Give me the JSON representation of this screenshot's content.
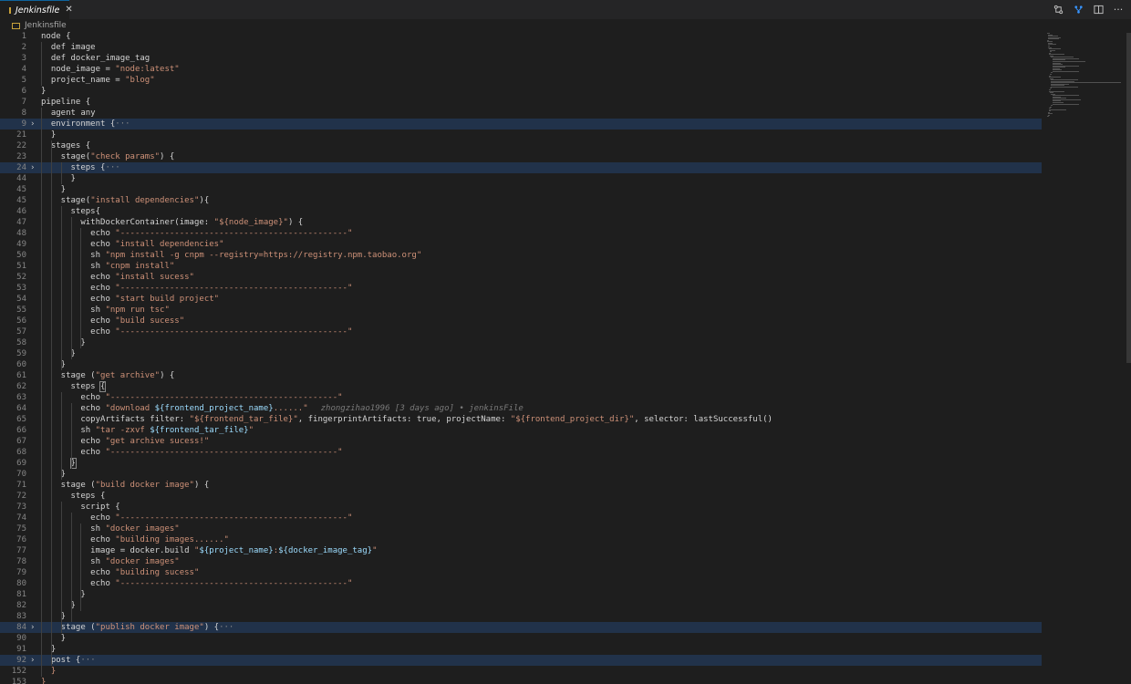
{
  "tab": {
    "label": "Jenkinsfile",
    "close": "✕"
  },
  "breadcrumb": {
    "label": "Jenkinsfile"
  },
  "actions": {
    "more": "···"
  },
  "blame": "zhongzihao1996 [3 days ago] • jenkinsFile",
  "lines": [
    {
      "n": "1",
      "fold": "",
      "hl": false,
      "code": [
        {
          "t": "node {",
          "c": "kw"
        }
      ]
    },
    {
      "n": "2",
      "fold": "",
      "hl": false,
      "code": [
        {
          "t": "  def image",
          "c": "kw"
        }
      ]
    },
    {
      "n": "3",
      "fold": "",
      "hl": false,
      "code": [
        {
          "t": "  def docker_image_tag",
          "c": "kw"
        }
      ]
    },
    {
      "n": "4",
      "fold": "",
      "hl": false,
      "code": [
        {
          "t": "  node_image = ",
          "c": "kw"
        },
        {
          "t": "\"node:latest\"",
          "c": "str"
        }
      ]
    },
    {
      "n": "5",
      "fold": "",
      "hl": false,
      "code": [
        {
          "t": "  project_name = ",
          "c": "kw"
        },
        {
          "t": "\"blog\"",
          "c": "str"
        }
      ]
    },
    {
      "n": "6",
      "fold": "",
      "hl": false,
      "code": [
        {
          "t": "}",
          "c": "kw"
        }
      ]
    },
    {
      "n": "7",
      "fold": "",
      "hl": false,
      "code": [
        {
          "t": "pipeline {",
          "c": "kw"
        }
      ]
    },
    {
      "n": "8",
      "fold": "",
      "hl": false,
      "code": [
        {
          "t": "  agent any",
          "c": "kw"
        }
      ]
    },
    {
      "n": "9",
      "fold": "›",
      "hl": true,
      "code": [
        {
          "t": "  environment {",
          "c": "kw"
        },
        {
          "t": "···",
          "c": "ell"
        }
      ]
    },
    {
      "n": "21",
      "fold": "",
      "hl": false,
      "code": [
        {
          "t": "  }",
          "c": "kw"
        }
      ]
    },
    {
      "n": "22",
      "fold": "",
      "hl": false,
      "code": [
        {
          "t": "  stages {",
          "c": "kw"
        }
      ]
    },
    {
      "n": "23",
      "fold": "",
      "hl": false,
      "code": [
        {
          "t": "    stage(",
          "c": "kw"
        },
        {
          "t": "\"check params\"",
          "c": "str"
        },
        {
          "t": ") {",
          "c": "kw"
        }
      ]
    },
    {
      "n": "24",
      "fold": "›",
      "hl": true,
      "code": [
        {
          "t": "      steps {",
          "c": "kw"
        },
        {
          "t": "···",
          "c": "ell"
        }
      ]
    },
    {
      "n": "44",
      "fold": "",
      "hl": false,
      "code": [
        {
          "t": "      }",
          "c": "kw"
        }
      ]
    },
    {
      "n": "45",
      "fold": "",
      "hl": false,
      "code": [
        {
          "t": "    }",
          "c": "kw"
        }
      ]
    },
    {
      "n": "45",
      "fold": "",
      "hl": false,
      "code": [
        {
          "t": "    stage(",
          "c": "kw"
        },
        {
          "t": "\"install dependencies\"",
          "c": "str"
        },
        {
          "t": "){",
          "c": "kw"
        }
      ]
    },
    {
      "n": "46",
      "fold": "",
      "hl": false,
      "code": [
        {
          "t": "      steps{",
          "c": "kw"
        }
      ]
    },
    {
      "n": "47",
      "fold": "",
      "hl": false,
      "code": [
        {
          "t": "        withDockerContainer(image: ",
          "c": "kw"
        },
        {
          "t": "\"${node_image}\"",
          "c": "str"
        },
        {
          "t": ") {",
          "c": "kw"
        }
      ]
    },
    {
      "n": "48",
      "fold": "",
      "hl": false,
      "code": [
        {
          "t": "          echo ",
          "c": "kw"
        },
        {
          "t": "\"----------------------------------------------\"",
          "c": "str"
        }
      ]
    },
    {
      "n": "49",
      "fold": "",
      "hl": false,
      "code": [
        {
          "t": "          echo ",
          "c": "kw"
        },
        {
          "t": "\"install dependencies\"",
          "c": "str"
        }
      ]
    },
    {
      "n": "50",
      "fold": "",
      "hl": false,
      "code": [
        {
          "t": "          sh ",
          "c": "kw"
        },
        {
          "t": "\"npm install -g cnpm --registry=https://registry.npm.taobao.org\"",
          "c": "str"
        }
      ]
    },
    {
      "n": "51",
      "fold": "",
      "hl": false,
      "code": [
        {
          "t": "          sh ",
          "c": "kw"
        },
        {
          "t": "\"cnpm install\"",
          "c": "str"
        }
      ]
    },
    {
      "n": "52",
      "fold": "",
      "hl": false,
      "code": [
        {
          "t": "          echo ",
          "c": "kw"
        },
        {
          "t": "\"install sucess\"",
          "c": "str"
        }
      ]
    },
    {
      "n": "53",
      "fold": "",
      "hl": false,
      "code": [
        {
          "t": "          echo ",
          "c": "kw"
        },
        {
          "t": "\"----------------------------------------------\"",
          "c": "str"
        }
      ]
    },
    {
      "n": "54",
      "fold": "",
      "hl": false,
      "code": [
        {
          "t": "          echo ",
          "c": "kw"
        },
        {
          "t": "\"start build project\"",
          "c": "str"
        }
      ]
    },
    {
      "n": "55",
      "fold": "",
      "hl": false,
      "code": [
        {
          "t": "          sh ",
          "c": "kw"
        },
        {
          "t": "\"npm run tsc\"",
          "c": "str"
        }
      ]
    },
    {
      "n": "56",
      "fold": "",
      "hl": false,
      "code": [
        {
          "t": "          echo ",
          "c": "kw"
        },
        {
          "t": "\"build sucess\"",
          "c": "str"
        }
      ]
    },
    {
      "n": "57",
      "fold": "",
      "hl": false,
      "code": [
        {
          "t": "          echo ",
          "c": "kw"
        },
        {
          "t": "\"----------------------------------------------\"",
          "c": "str"
        }
      ]
    },
    {
      "n": "58",
      "fold": "",
      "hl": false,
      "code": [
        {
          "t": "        }",
          "c": "kw"
        }
      ]
    },
    {
      "n": "59",
      "fold": "",
      "hl": false,
      "code": [
        {
          "t": "      }",
          "c": "kw"
        }
      ]
    },
    {
      "n": "60",
      "fold": "",
      "hl": false,
      "code": [
        {
          "t": "    }",
          "c": "kw"
        }
      ]
    },
    {
      "n": "61",
      "fold": "",
      "hl": false,
      "code": [
        {
          "t": "    stage (",
          "c": "kw"
        },
        {
          "t": "\"get archive\"",
          "c": "str"
        },
        {
          "t": ") {",
          "c": "kw"
        }
      ]
    },
    {
      "n": "62",
      "fold": "",
      "hl": false,
      "code": [
        {
          "t": "      steps ",
          "c": "kw"
        },
        {
          "t": "{",
          "c": "box"
        }
      ]
    },
    {
      "n": "63",
      "fold": "",
      "hl": false,
      "code": [
        {
          "t": "        echo ",
          "c": "kw"
        },
        {
          "t": "\"----------------------------------------------\"",
          "c": "str"
        }
      ]
    },
    {
      "n": "64",
      "fold": "",
      "hl": false,
      "blame": true,
      "code": [
        {
          "t": "        echo ",
          "c": "kw"
        },
        {
          "t": "\"download ",
          "c": "str"
        },
        {
          "t": "${frontend_project_name}",
          "c": "var"
        },
        {
          "t": "......\"",
          "c": "str"
        }
      ]
    },
    {
      "n": "65",
      "fold": "",
      "hl": false,
      "code": [
        {
          "t": "        copyArtifacts filter: ",
          "c": "kw"
        },
        {
          "t": "\"${frontend_tar_file}\"",
          "c": "str"
        },
        {
          "t": ", fingerprintArtifacts: true, projectName: ",
          "c": "kw"
        },
        {
          "t": "\"${frontend_project_dir}\"",
          "c": "str"
        },
        {
          "t": ", selector: lastSuccessful()",
          "c": "kw"
        }
      ]
    },
    {
      "n": "66",
      "fold": "",
      "hl": false,
      "code": [
        {
          "t": "        sh ",
          "c": "kw"
        },
        {
          "t": "\"tar -zxvf ",
          "c": "str"
        },
        {
          "t": "${frontend_tar_file}",
          "c": "var"
        },
        {
          "t": "\"",
          "c": "str"
        }
      ]
    },
    {
      "n": "67",
      "fold": "",
      "hl": false,
      "code": [
        {
          "t": "        echo ",
          "c": "kw"
        },
        {
          "t": "\"get archive sucess!\"",
          "c": "str"
        }
      ]
    },
    {
      "n": "68",
      "fold": "",
      "hl": false,
      "code": [
        {
          "t": "        echo ",
          "c": "kw"
        },
        {
          "t": "\"----------------------------------------------\"",
          "c": "str"
        }
      ]
    },
    {
      "n": "69",
      "fold": "",
      "hl": false,
      "code": [
        {
          "t": "      ",
          "c": "kw"
        },
        {
          "t": "}",
          "c": "box"
        }
      ]
    },
    {
      "n": "70",
      "fold": "",
      "hl": false,
      "code": [
        {
          "t": "    }",
          "c": "kw"
        }
      ]
    },
    {
      "n": "71",
      "fold": "",
      "hl": false,
      "code": [
        {
          "t": "    stage (",
          "c": "kw"
        },
        {
          "t": "\"build docker image\"",
          "c": "str"
        },
        {
          "t": ") {",
          "c": "kw"
        }
      ]
    },
    {
      "n": "72",
      "fold": "",
      "hl": false,
      "code": [
        {
          "t": "      steps {",
          "c": "kw"
        }
      ]
    },
    {
      "n": "73",
      "fold": "",
      "hl": false,
      "code": [
        {
          "t": "        script {",
          "c": "kw"
        }
      ]
    },
    {
      "n": "74",
      "fold": "",
      "hl": false,
      "code": [
        {
          "t": "          echo ",
          "c": "kw"
        },
        {
          "t": "\"----------------------------------------------\"",
          "c": "str"
        }
      ]
    },
    {
      "n": "75",
      "fold": "",
      "hl": false,
      "code": [
        {
          "t": "          sh ",
          "c": "kw"
        },
        {
          "t": "\"docker images\"",
          "c": "str"
        }
      ]
    },
    {
      "n": "76",
      "fold": "",
      "hl": false,
      "code": [
        {
          "t": "          echo ",
          "c": "kw"
        },
        {
          "t": "\"building images......\"",
          "c": "str"
        }
      ]
    },
    {
      "n": "77",
      "fold": "",
      "hl": false,
      "code": [
        {
          "t": "          image = docker.build ",
          "c": "kw"
        },
        {
          "t": "\"",
          "c": "str"
        },
        {
          "t": "${project_name}",
          "c": "var"
        },
        {
          "t": ":",
          "c": "str"
        },
        {
          "t": "${docker_image_tag}",
          "c": "var"
        },
        {
          "t": "\"",
          "c": "str"
        }
      ]
    },
    {
      "n": "78",
      "fold": "",
      "hl": false,
      "code": [
        {
          "t": "          sh ",
          "c": "kw"
        },
        {
          "t": "\"docker images\"",
          "c": "str"
        }
      ]
    },
    {
      "n": "79",
      "fold": "",
      "hl": false,
      "code": [
        {
          "t": "          echo ",
          "c": "kw"
        },
        {
          "t": "\"building sucess\"",
          "c": "str"
        }
      ]
    },
    {
      "n": "80",
      "fold": "",
      "hl": false,
      "code": [
        {
          "t": "          echo ",
          "c": "kw"
        },
        {
          "t": "\"----------------------------------------------\"",
          "c": "str"
        }
      ]
    },
    {
      "n": "81",
      "fold": "",
      "hl": false,
      "code": [
        {
          "t": "        }",
          "c": "kw"
        }
      ]
    },
    {
      "n": "82",
      "fold": "",
      "hl": false,
      "code": [
        {
          "t": "      }",
          "c": "kw"
        }
      ]
    },
    {
      "n": "83",
      "fold": "",
      "hl": false,
      "code": [
        {
          "t": "    }",
          "c": "kw"
        }
      ]
    },
    {
      "n": "84",
      "fold": "›",
      "hl": true,
      "code": [
        {
          "t": "    stage (",
          "c": "kw"
        },
        {
          "t": "\"publish docker image\"",
          "c": "str"
        },
        {
          "t": ") {",
          "c": "kw"
        },
        {
          "t": "···",
          "c": "ell"
        }
      ]
    },
    {
      "n": "90",
      "fold": "",
      "hl": false,
      "code": [
        {
          "t": "    }",
          "c": "kw"
        }
      ]
    },
    {
      "n": "91",
      "fold": "",
      "hl": false,
      "code": [
        {
          "t": "  }",
          "c": "kw"
        }
      ]
    },
    {
      "n": "92",
      "fold": "›",
      "hl": true,
      "code": [
        {
          "t": "  post {",
          "c": "kw"
        },
        {
          "t": "···",
          "c": "ell"
        }
      ]
    },
    {
      "n": "152",
      "fold": "",
      "hl": false,
      "code": [
        {
          "t": "  }",
          "c": "str"
        }
      ]
    },
    {
      "n": "153",
      "fold": "",
      "hl": false,
      "code": [
        {
          "t": "}",
          "c": "str"
        }
      ]
    }
  ]
}
